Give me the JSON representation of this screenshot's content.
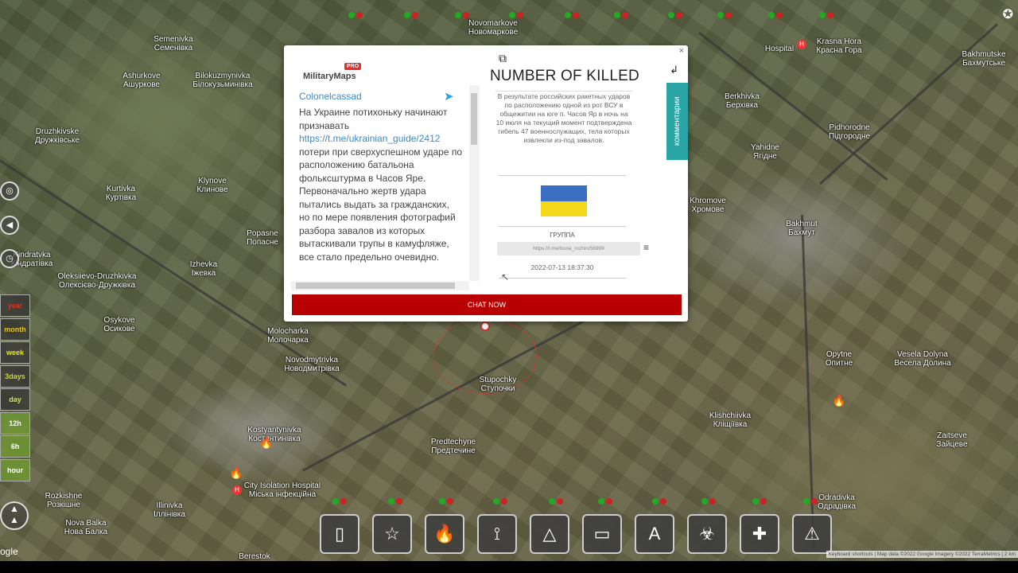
{
  "map_labels": [
    [
      "Semenivka",
      "Семенівка"
    ],
    [
      "Ashurkove",
      "Ашуркове"
    ],
    [
      "Bilokuzmynivka",
      "Білокузьминівка"
    ],
    [
      "Novomarkove",
      "Новомаркове"
    ],
    [
      "Druzhkivske",
      "Дружківське"
    ],
    [
      "Kurtivka",
      "Куртівка"
    ],
    [
      "Klynove",
      "Клинове"
    ],
    [
      "Popasne",
      "Попасне"
    ],
    [
      "Izhevka",
      "Іжевка"
    ],
    [
      "Kindratvka",
      "Кіндратівка"
    ],
    [
      "Oleksiievo-Druzhkivka",
      "Олексієво-Дружківка"
    ],
    [
      "Osykove",
      "Осикове"
    ],
    [
      "Molocharka",
      "Молочарка"
    ],
    [
      "Novodmytrivka",
      "Новодмитрівка"
    ],
    [
      "Stupochky",
      "Ступочки"
    ],
    [
      "Kostyantynivka",
      "Костянтинівка"
    ],
    [
      "Predtechyne",
      "Предтечине"
    ],
    [
      "City Isolation Hospital",
      "Міська інфекційна"
    ],
    [
      "Rozkishne",
      "Розкішне"
    ],
    [
      "Illinivka",
      "Іллінівка"
    ],
    [
      "Nova Balka",
      "Нова Балка"
    ],
    [
      "Berestok",
      ""
    ],
    [
      "Krasna Hora",
      "Красна Гора"
    ],
    [
      "Bakhmutske",
      "Бахмутське"
    ],
    [
      "Berkhivka",
      "Берхівка"
    ],
    [
      "Pidhorodne",
      "Підгородне"
    ],
    [
      "Yahidne",
      "Ягідне"
    ],
    [
      "Khromove",
      "Хромове"
    ],
    [
      "Bakhmut",
      "Бахмут"
    ],
    [
      "Opytne",
      "Опитне"
    ],
    [
      "Vesela Dolyna",
      "Весела Долина"
    ],
    [
      "Klishchiivka",
      "Кліщіївка"
    ],
    [
      "Zaitseve",
      "Зайцеве"
    ],
    [
      "Odradivka",
      "Одрадівка"
    ],
    [
      "Hospital",
      ""
    ]
  ],
  "popup": {
    "logo": "MilitaryMaps",
    "logo_badge": "PRO",
    "author": "Colonelcassad",
    "post_before": "На Украине потихоньку начинают признавать",
    "post_link": "https://t.me/ukrainian_guide/2412",
    "post_after": "потери при сверхуспешном ударе по расположению батальона фольксштурма в Часов Яре. Первоначально жертв удара пытались выдать за гражданских, но по мере появления фотографий разбора завалов из которых вытаскивали трупы в камуфляже, все стало предельно очевидно.",
    "title": "NUMBER OF KILLED",
    "description": "В результате российских ракетных ударов по расположению одной из рот ВСУ в общежитии на юге п. Часов Яр в ночь на 10 июля на текущий момент подтверждена гибель 47 военнослужащих, тела которых извлекли из-под завалов.",
    "group_label": "ГРУППА",
    "url": "https://t.me/bona_rozhin/56999",
    "date": "2022-07-13 18:37:30",
    "comments_tab": "комментарии",
    "chat_button": "CHAT NOW",
    "close": "×"
  },
  "time_filters": [
    {
      "label": "year",
      "color": "#e03020"
    },
    {
      "label": "month",
      "color": "#e8c020"
    },
    {
      "label": "week",
      "color": "#e8e020"
    },
    {
      "label": "3days",
      "color": "#c8d838"
    },
    {
      "label": "day",
      "color": "#c8e070"
    },
    {
      "label": "12h",
      "color": "#ffffff"
    },
    {
      "label": "6h",
      "color": "#ffffff"
    },
    {
      "label": "hour",
      "color": "#ffffff"
    }
  ],
  "toolbar": [
    "notes",
    "star",
    "fire",
    "route",
    "triangle",
    "ruler",
    "text",
    "biohazard",
    "hospital",
    "warning"
  ],
  "attribution": "Keyboard shortcuts | Map data ©2022 Google Imagery ©2022 TerraMetrics | 2 km",
  "google_text": "ogle"
}
